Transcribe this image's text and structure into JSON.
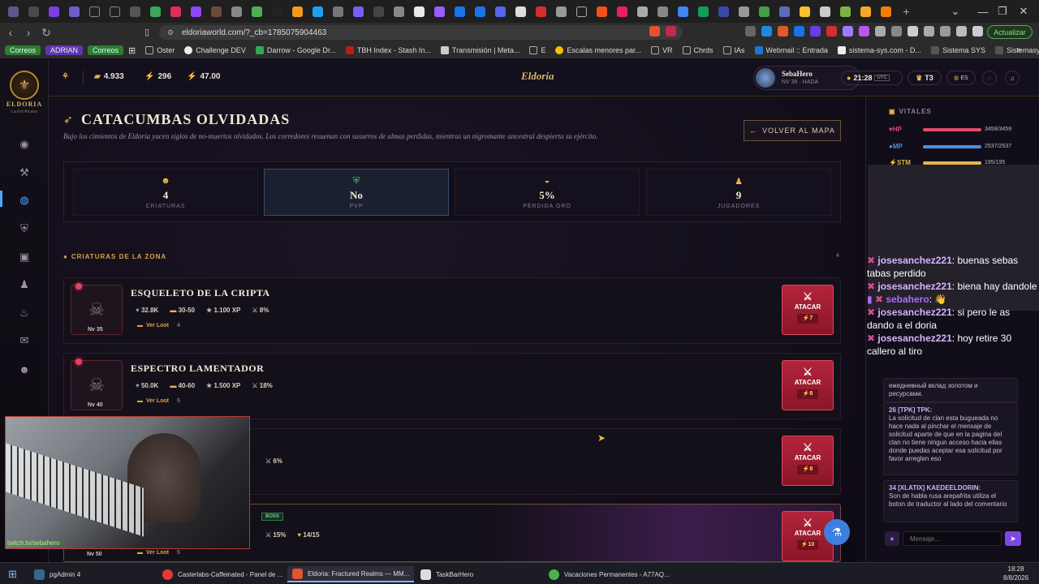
{
  "browser": {
    "url": "eldoriaworld.com/?_cb=1785075904463",
    "update_label": "Actualizar",
    "bookmarks_chips": [
      "Correos",
      "ADRIAN",
      "Correos"
    ],
    "bookmarks": [
      "Oster",
      "Challenge DEV",
      "Darrow - Google Dr...",
      "TBH Index - Stash In...",
      "Transmisión | Meta...",
      "E",
      "Escalas menores par...",
      "VR",
      "Chrds",
      "IAs",
      "Webmail :: Entrada",
      "sistema-sys.com - D...",
      "Sistema SYS",
      "Sistemasys.tech"
    ]
  },
  "game": {
    "logo": "ELDORIA",
    "logo_sub": "La Era Arcana",
    "brand": "Eldoria",
    "gold": "4.933",
    "gems": "296",
    "energy": "47.00",
    "player_name": "SebaHero",
    "player_level": "NV 38 · HADA",
    "clock": "21:28",
    "tz": "UTC",
    "tier": "T3",
    "lang": "ES",
    "zone_title": "CATACUMBAS OLVIDADAS",
    "zone_desc": "Bajo los cimientos de Eldoria yacen siglos de no-muertos olvidados. Los corredores resuenan con susurros de almas perdidas, mientras un nigromante ancestral despierta su ejército.",
    "back_label": "VOLVER AL MAPA",
    "stats": [
      {
        "icon": "skull-icon",
        "value": "4",
        "label": "CRIATURAS"
      },
      {
        "icon": "shield-icon",
        "value": "No",
        "label": "PVP"
      },
      {
        "icon": "gold-icon",
        "value": "5%",
        "label": "PÉRDIDA ORO"
      },
      {
        "icon": "players-icon",
        "value": "9",
        "label": "JUGADORES"
      }
    ],
    "section_label": "CRIATURAS DE LA ZONA",
    "section_count": "4",
    "creatures": [
      {
        "name": "ESQUELETO DE LA CRIPTA",
        "level": "Nv 35",
        "hp": "32.8K",
        "gold": "30-50",
        "xp": "1.100 XP",
        "pct": "8%",
        "loot": "Ver Loot",
        "loot_n": "4",
        "energy": "7"
      },
      {
        "name": "ESPECTRO LAMENTADOR",
        "level": "Nv 40",
        "hp": "50.0K",
        "gold": "40-60",
        "xp": "1.500 XP",
        "pct": "18%",
        "loot": "Ver Loot",
        "loot_n": "5",
        "energy": "8"
      },
      {
        "name": "",
        "level": "",
        "hp": "",
        "gold": "",
        "xp": "",
        "pct": "6%",
        "loot": "",
        "loot_n": "",
        "energy": "8"
      },
      {
        "name": "",
        "level": "Nv 50",
        "hp": "",
        "gold": "",
        "xp": "",
        "pct": "15%",
        "loot": "Ver Loot",
        "loot_n": "5",
        "energy": "10",
        "boss": "BOSS",
        "count": "14/15"
      }
    ],
    "attack_label": "ATACAR",
    "vitals_title": "VITALES",
    "vitals": [
      {
        "name": "HP",
        "value": "3459/3459",
        "color": "#e64b6a"
      },
      {
        "name": "MP",
        "value": "2537/2537",
        "color": "#4a8fe6"
      },
      {
        "name": "STM",
        "value": "195/195",
        "color": "#e6b84a"
      }
    ],
    "chat_overlay": [
      {
        "user": "josesanchez221",
        "text": "buenas sebas tabas perdido"
      },
      {
        "user": "josesanchez221",
        "text": "biena hay dandole"
      },
      {
        "user": "sebahero",
        "text": "👋"
      },
      {
        "user": "josesanchez221",
        "text": "si pero le as dando a el doria"
      },
      {
        "user": "josesanchez221",
        "text": "hoy retire 30 callero al tiro"
      }
    ],
    "chat_cards": [
      {
        "head": "",
        "text": "ежедневный вклад золотом и ресурсами."
      },
      {
        "head": "26 [TPK] TPK:",
        "text": "La solicitud de clan esta bugueada no hace nada al pinchar el mensaje de solicitud aparte de que en la pagina del clan no tiene ningun acceso hacia ellas donde puedas aceptar esa solicitud por favor arreglen eso"
      },
      {
        "head": "34 [XLATIX] KAEDEELDORIN:",
        "text": "Son de habla rusa arepafrita utiliza el boton de traductor al lado del comentario"
      }
    ],
    "chat_placeholder": "Mensaje..."
  },
  "webcam_caption": "twitch.tv/sebahero",
  "taskbar": {
    "items": [
      "pgAdmin 4",
      "Casterlabs-Caffeinated - Panel de ...",
      "Eldoria: Fractured Realms — MM...",
      "TaskBarHero",
      "Vacaciones Permanentes - A77AQ..."
    ],
    "time": "18:28",
    "date": "8/8/2026"
  }
}
